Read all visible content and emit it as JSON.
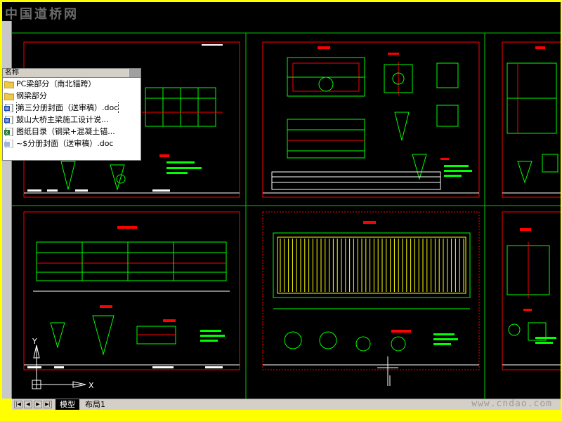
{
  "watermarks": {
    "top": "中国道桥网",
    "bottom": "www.cndao.com"
  },
  "file_panel": {
    "column_header": "名称",
    "items": [
      {
        "name": "PC梁部分（南北锚跨）",
        "type": "folder",
        "icon": "folder-icon"
      },
      {
        "name": "钢梁部分",
        "type": "folder",
        "icon": "folder-icon"
      },
      {
        "name": "第三分册封面（送审稿）.doc",
        "type": "word",
        "icon": "word-doc-icon",
        "selected": true
      },
      {
        "name": "鼓山大桥主梁施工设计说...",
        "type": "word",
        "icon": "word-doc-icon"
      },
      {
        "name": "图纸目录（钢梁+混凝土锚...",
        "type": "excel",
        "icon": "excel-icon"
      },
      {
        "name": "~$分册封面（送审稿）.doc",
        "type": "temp",
        "icon": "temp-doc-icon"
      }
    ]
  },
  "layout_tabs": {
    "nav_buttons": [
      "|◀",
      "◀",
      "▶",
      "▶|"
    ],
    "tabs": [
      {
        "label": "模型",
        "active": true
      },
      {
        "label": "布局1",
        "active": false
      }
    ]
  },
  "ucs": {
    "x_label": "X",
    "y_label": "Y"
  },
  "colors": {
    "frame": "#ffff00",
    "canvas": "#000000",
    "grid": "#00c800",
    "border": "#ff0000",
    "drawing": "#00ff00",
    "accent_red": "#ff0000",
    "accent_white": "#ffffff"
  }
}
